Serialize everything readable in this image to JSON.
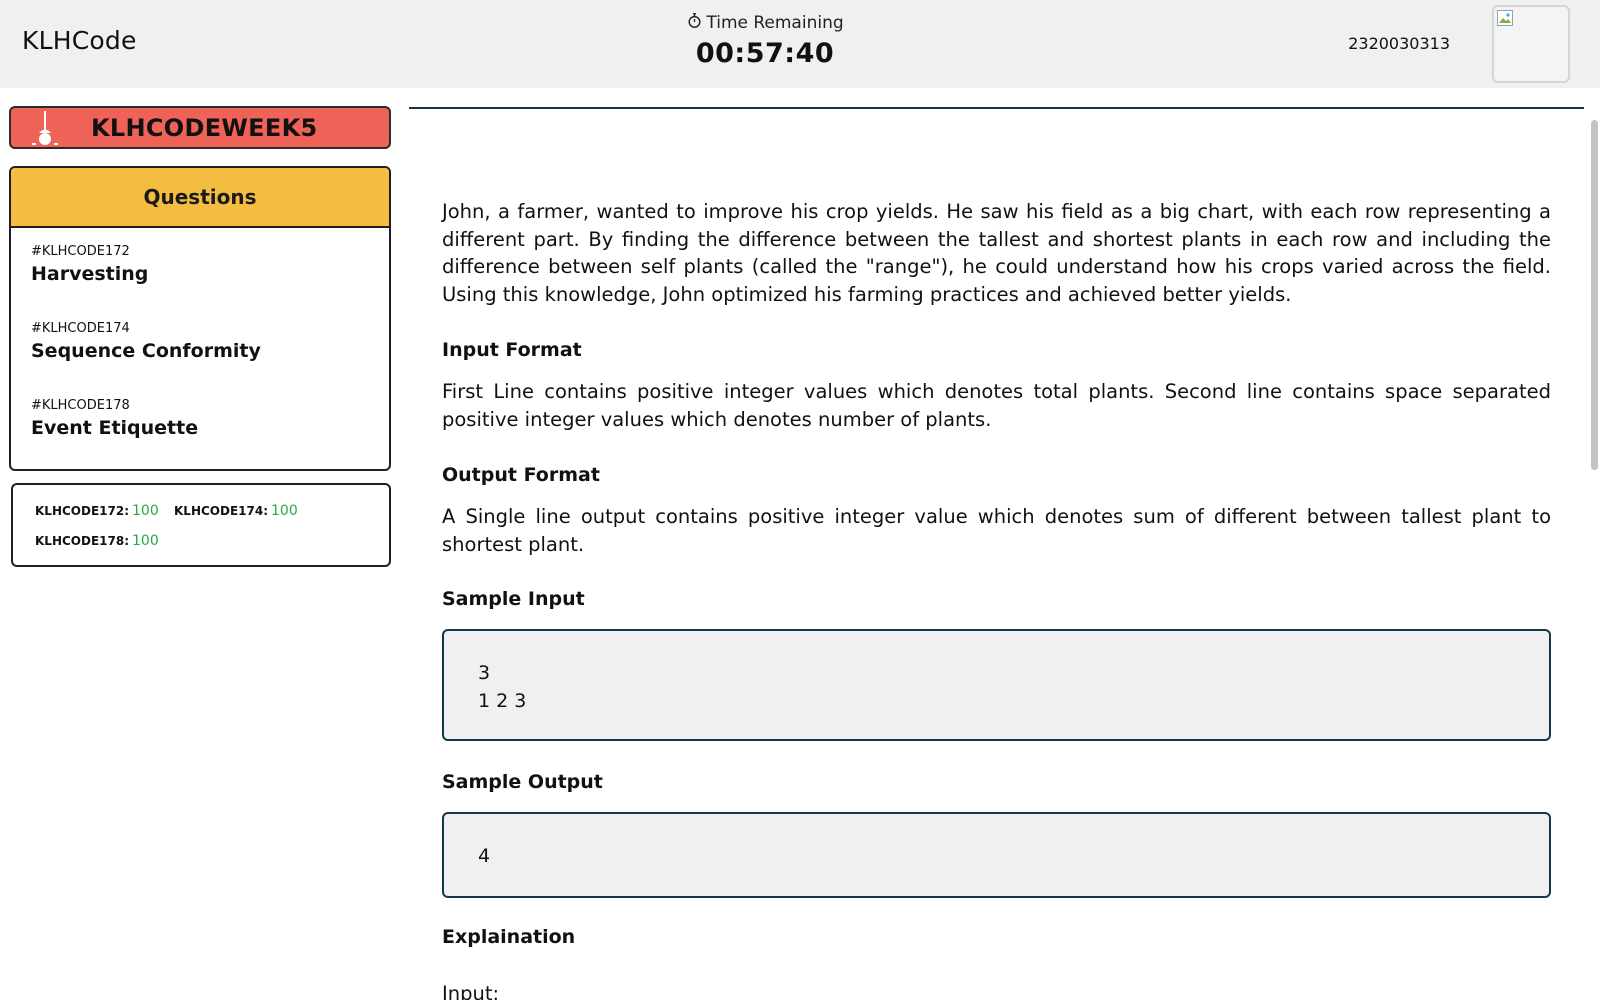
{
  "header": {
    "brand": "KLHCode",
    "timer_label": "Time Remaining",
    "timer_value": "00:57:40",
    "user_id": "2320030313"
  },
  "sidebar": {
    "contest_title": "KLHCODEWEEK5",
    "questions_header": "Questions",
    "questions": [
      {
        "code": "#KLHCODE172",
        "title": "Harvesting"
      },
      {
        "code": "#KLHCODE174",
        "title": "Sequence Conformity"
      },
      {
        "code": "#KLHCODE178",
        "title": "Event Etiquette"
      }
    ],
    "scores": [
      {
        "label": "KLHCODE172:",
        "value": "100"
      },
      {
        "label": "KLHCODE174:",
        "value": "100"
      },
      {
        "label": "KLHCODE178:",
        "value": "100"
      }
    ]
  },
  "problem": {
    "description": "John, a farmer, wanted to improve his crop yields. He saw his field as a big chart, with each row representing a different part. By finding the difference between the tallest and shortest plants in each row and including the difference between self plants (called the \"range\"), he could understand how his crops varied across the field. Using this knowledge, John optimized his farming practices and achieved better yields.",
    "input_format_title": "Input Format",
    "input_format": "First Line contains positive integer values which denotes total plants. Second line contains space separated positive integer values which denotes number of plants.",
    "output_format_title": "Output Format",
    "output_format": "A Single line output contains positive integer value which denotes sum of different between tallest plant to shortest plant.",
    "sample_input_title": "Sample Input",
    "sample_input_line1": "3",
    "sample_input_line2": "1 2 3",
    "sample_output_title": "Sample Output",
    "sample_output": "4",
    "explanation_title": "Explaination",
    "explanation_input_label": "Input:"
  },
  "colors": {
    "header_bg": "#eff0f2",
    "contest_banner": "#ee6257",
    "questions_header": "#f4bd41",
    "score_value": "#28a745",
    "accent_border": "#12384a"
  },
  "icons": {
    "timer": "stopwatch-icon",
    "contest": "lamp-icon",
    "avatar": "broken-image-icon"
  }
}
